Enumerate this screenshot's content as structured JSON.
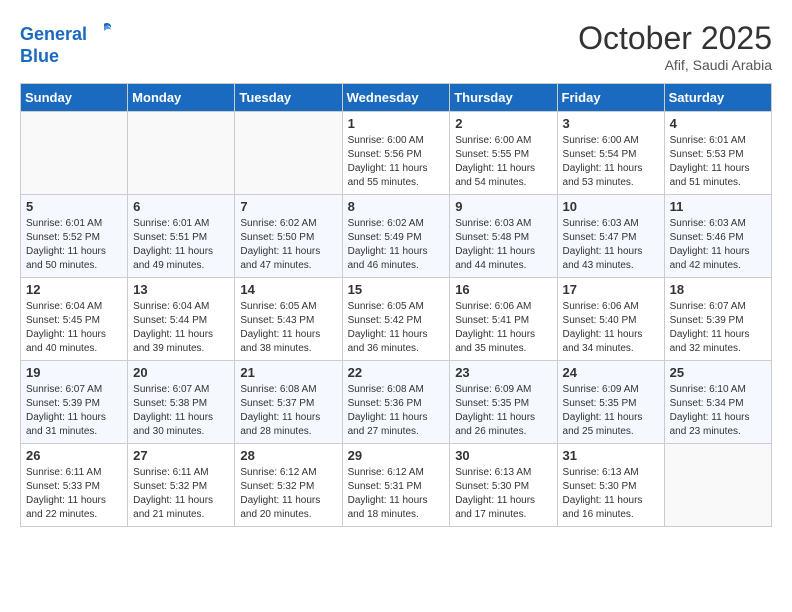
{
  "header": {
    "logo_line1": "General",
    "logo_line2": "Blue",
    "month_title": "October 2025",
    "subtitle": "Afif, Saudi Arabia"
  },
  "weekdays": [
    "Sunday",
    "Monday",
    "Tuesday",
    "Wednesday",
    "Thursday",
    "Friday",
    "Saturday"
  ],
  "weeks": [
    [
      {
        "day": "",
        "info": ""
      },
      {
        "day": "",
        "info": ""
      },
      {
        "day": "",
        "info": ""
      },
      {
        "day": "1",
        "info": "Sunrise: 6:00 AM\nSunset: 5:56 PM\nDaylight: 11 hours\nand 55 minutes."
      },
      {
        "day": "2",
        "info": "Sunrise: 6:00 AM\nSunset: 5:55 PM\nDaylight: 11 hours\nand 54 minutes."
      },
      {
        "day": "3",
        "info": "Sunrise: 6:00 AM\nSunset: 5:54 PM\nDaylight: 11 hours\nand 53 minutes."
      },
      {
        "day": "4",
        "info": "Sunrise: 6:01 AM\nSunset: 5:53 PM\nDaylight: 11 hours\nand 51 minutes."
      }
    ],
    [
      {
        "day": "5",
        "info": "Sunrise: 6:01 AM\nSunset: 5:52 PM\nDaylight: 11 hours\nand 50 minutes."
      },
      {
        "day": "6",
        "info": "Sunrise: 6:01 AM\nSunset: 5:51 PM\nDaylight: 11 hours\nand 49 minutes."
      },
      {
        "day": "7",
        "info": "Sunrise: 6:02 AM\nSunset: 5:50 PM\nDaylight: 11 hours\nand 47 minutes."
      },
      {
        "day": "8",
        "info": "Sunrise: 6:02 AM\nSunset: 5:49 PM\nDaylight: 11 hours\nand 46 minutes."
      },
      {
        "day": "9",
        "info": "Sunrise: 6:03 AM\nSunset: 5:48 PM\nDaylight: 11 hours\nand 44 minutes."
      },
      {
        "day": "10",
        "info": "Sunrise: 6:03 AM\nSunset: 5:47 PM\nDaylight: 11 hours\nand 43 minutes."
      },
      {
        "day": "11",
        "info": "Sunrise: 6:03 AM\nSunset: 5:46 PM\nDaylight: 11 hours\nand 42 minutes."
      }
    ],
    [
      {
        "day": "12",
        "info": "Sunrise: 6:04 AM\nSunset: 5:45 PM\nDaylight: 11 hours\nand 40 minutes."
      },
      {
        "day": "13",
        "info": "Sunrise: 6:04 AM\nSunset: 5:44 PM\nDaylight: 11 hours\nand 39 minutes."
      },
      {
        "day": "14",
        "info": "Sunrise: 6:05 AM\nSunset: 5:43 PM\nDaylight: 11 hours\nand 38 minutes."
      },
      {
        "day": "15",
        "info": "Sunrise: 6:05 AM\nSunset: 5:42 PM\nDaylight: 11 hours\nand 36 minutes."
      },
      {
        "day": "16",
        "info": "Sunrise: 6:06 AM\nSunset: 5:41 PM\nDaylight: 11 hours\nand 35 minutes."
      },
      {
        "day": "17",
        "info": "Sunrise: 6:06 AM\nSunset: 5:40 PM\nDaylight: 11 hours\nand 34 minutes."
      },
      {
        "day": "18",
        "info": "Sunrise: 6:07 AM\nSunset: 5:39 PM\nDaylight: 11 hours\nand 32 minutes."
      }
    ],
    [
      {
        "day": "19",
        "info": "Sunrise: 6:07 AM\nSunset: 5:39 PM\nDaylight: 11 hours\nand 31 minutes."
      },
      {
        "day": "20",
        "info": "Sunrise: 6:07 AM\nSunset: 5:38 PM\nDaylight: 11 hours\nand 30 minutes."
      },
      {
        "day": "21",
        "info": "Sunrise: 6:08 AM\nSunset: 5:37 PM\nDaylight: 11 hours\nand 28 minutes."
      },
      {
        "day": "22",
        "info": "Sunrise: 6:08 AM\nSunset: 5:36 PM\nDaylight: 11 hours\nand 27 minutes."
      },
      {
        "day": "23",
        "info": "Sunrise: 6:09 AM\nSunset: 5:35 PM\nDaylight: 11 hours\nand 26 minutes."
      },
      {
        "day": "24",
        "info": "Sunrise: 6:09 AM\nSunset: 5:35 PM\nDaylight: 11 hours\nand 25 minutes."
      },
      {
        "day": "25",
        "info": "Sunrise: 6:10 AM\nSunset: 5:34 PM\nDaylight: 11 hours\nand 23 minutes."
      }
    ],
    [
      {
        "day": "26",
        "info": "Sunrise: 6:11 AM\nSunset: 5:33 PM\nDaylight: 11 hours\nand 22 minutes."
      },
      {
        "day": "27",
        "info": "Sunrise: 6:11 AM\nSunset: 5:32 PM\nDaylight: 11 hours\nand 21 minutes."
      },
      {
        "day": "28",
        "info": "Sunrise: 6:12 AM\nSunset: 5:32 PM\nDaylight: 11 hours\nand 20 minutes."
      },
      {
        "day": "29",
        "info": "Sunrise: 6:12 AM\nSunset: 5:31 PM\nDaylight: 11 hours\nand 18 minutes."
      },
      {
        "day": "30",
        "info": "Sunrise: 6:13 AM\nSunset: 5:30 PM\nDaylight: 11 hours\nand 17 minutes."
      },
      {
        "day": "31",
        "info": "Sunrise: 6:13 AM\nSunset: 5:30 PM\nDaylight: 11 hours\nand 16 minutes."
      },
      {
        "day": "",
        "info": ""
      }
    ]
  ]
}
